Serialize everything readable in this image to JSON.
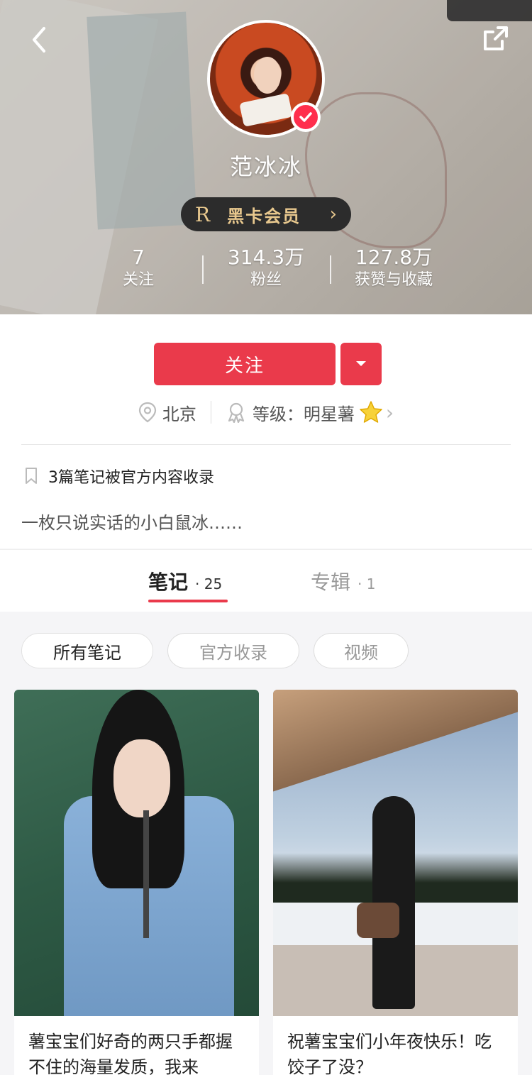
{
  "header": {
    "username": "范冰冰",
    "vip": {
      "badge": "R",
      "label": "黑卡会员"
    },
    "stats": [
      {
        "value": "7",
        "label": "关注"
      },
      {
        "value": "314.3万",
        "label": "粉丝"
      },
      {
        "value": "127.8万",
        "label": "获赞与收藏"
      }
    ]
  },
  "profile": {
    "follow_label": "关注",
    "location": "北京",
    "level_label": "等级：明星薯",
    "collected_text": "3篇笔记被官方内容收录",
    "bio": "一枚只说实话的小白鼠冰……"
  },
  "tabs": [
    {
      "label": "笔记",
      "count": "· 25",
      "active": true
    },
    {
      "label": "专辑",
      "count": "· 1",
      "active": false
    }
  ],
  "filters": [
    "所有笔记",
    "官方收录",
    "视频"
  ],
  "notes": [
    {
      "title": "薯宝宝们好奇的两只手都握不住的海量发质，我来"
    },
    {
      "title": "祝薯宝宝们小年夜快乐！吃饺子了没？"
    }
  ],
  "colors": {
    "accent": "#ea3a4b",
    "vip_gold": "#e8c88e"
  }
}
